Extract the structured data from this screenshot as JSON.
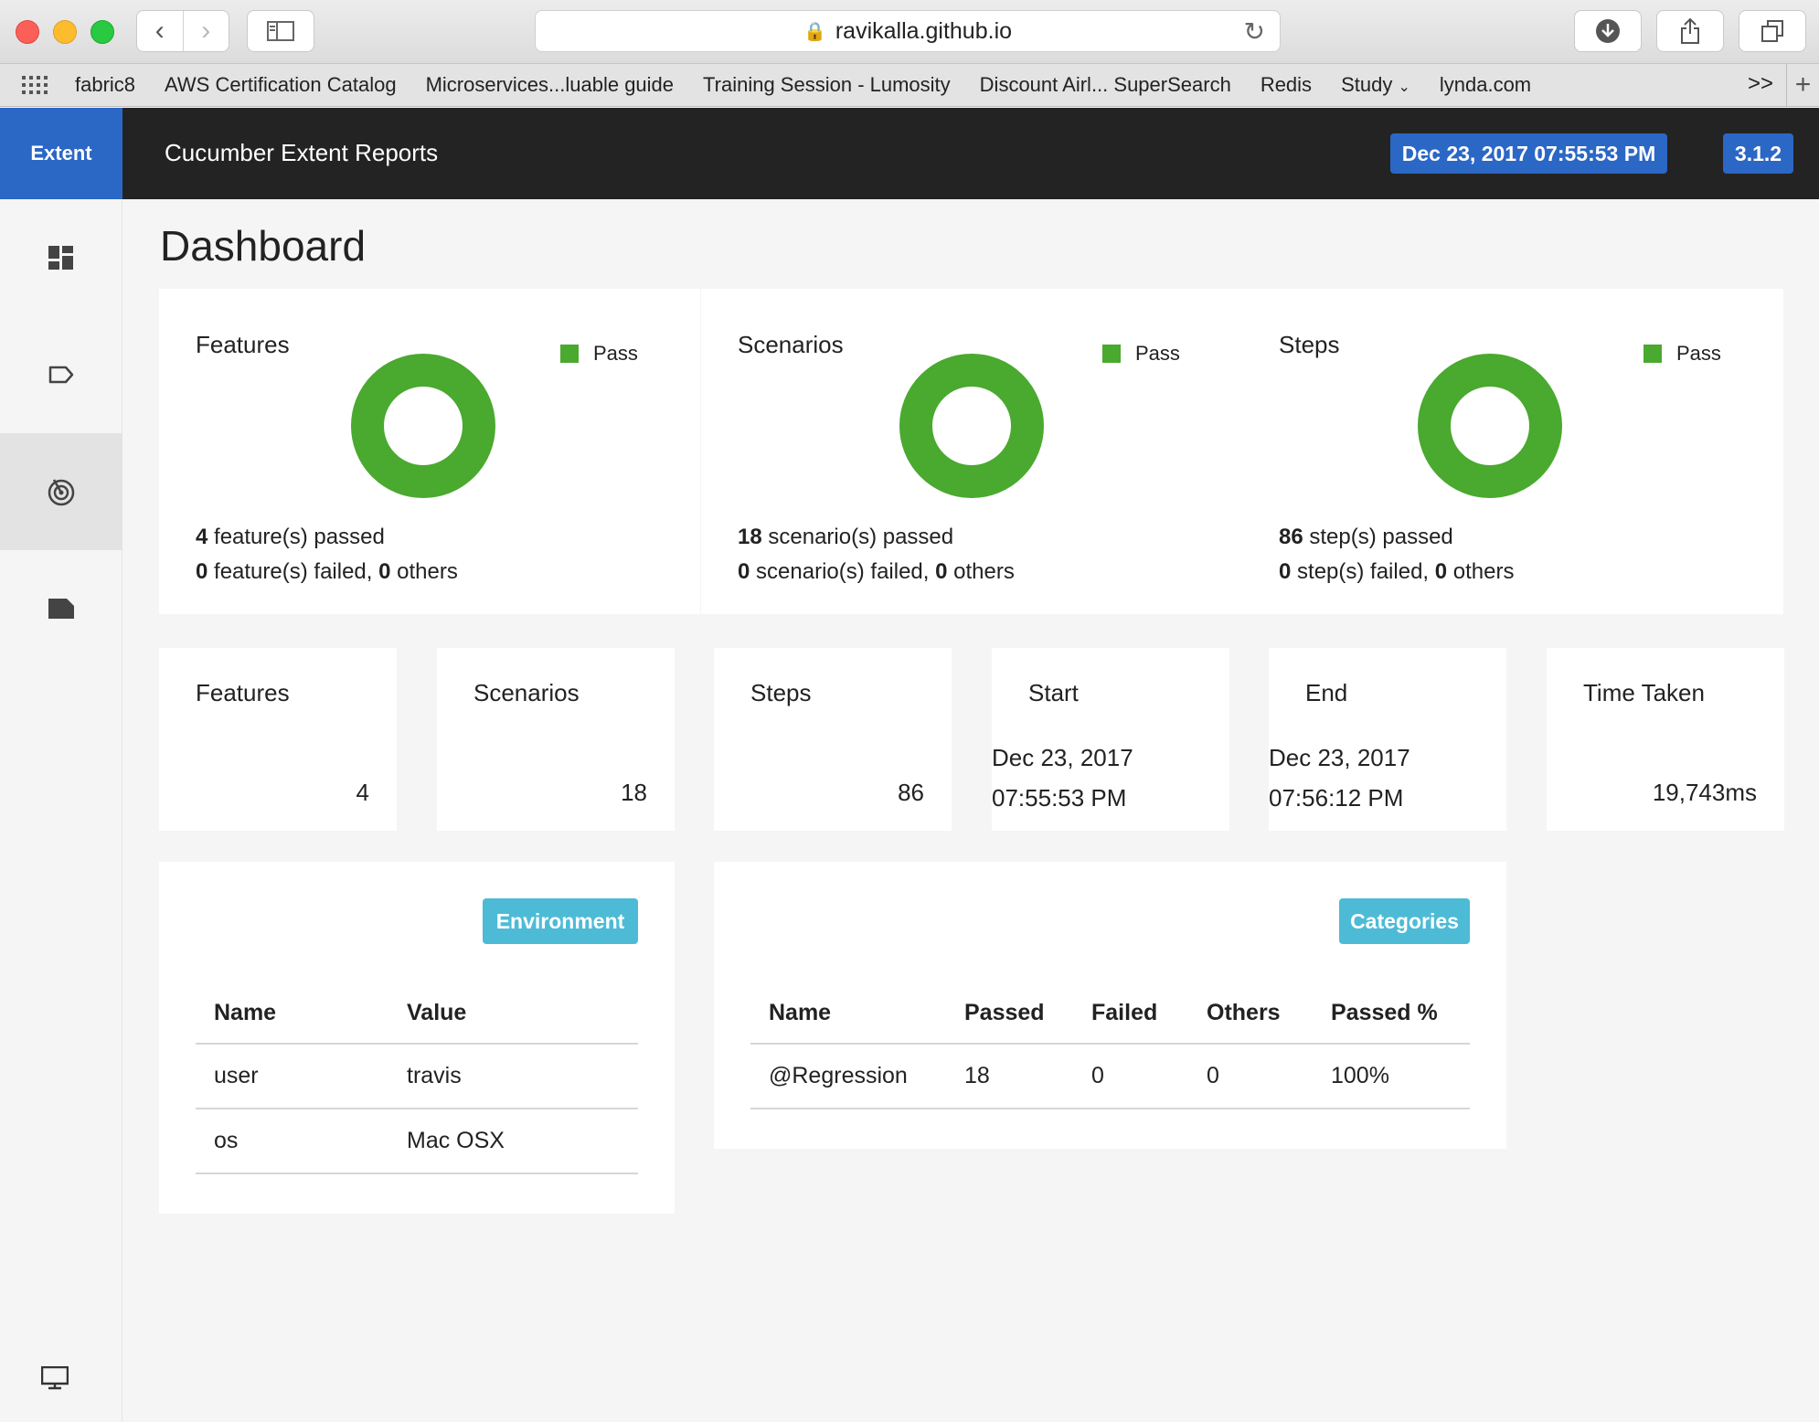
{
  "browser": {
    "url": "ravikalla.github.io",
    "bookmarks": [
      "fabric8",
      "AWS Certification Catalog",
      "Microservices...luable guide",
      "Training Session - Lumosity",
      "Discount Airl... SuperSearch",
      "Redis",
      "Study",
      "lynda.com"
    ],
    "more": ">>"
  },
  "app": {
    "brand": "Extent",
    "title": "Cucumber Extent Reports",
    "date": "Dec 23, 2017 07:55:53 PM",
    "version": "3.1.2"
  },
  "sidenav": {
    "icons": [
      "dashboard-icon",
      "tag-icon",
      "radar-icon",
      "folder-icon",
      "monitor-icon"
    ],
    "active_index": 2
  },
  "dashboard": {
    "title": "Dashboard",
    "charts": [
      {
        "title": "Features",
        "legend": "Pass",
        "passed_count": "4",
        "passed_text": " feature(s) passed",
        "failed_count": "0",
        "failed_text": " feature(s) failed, ",
        "others_count": "0",
        "others_text": " others"
      },
      {
        "title": "Scenarios",
        "legend": "Pass",
        "passed_count": "18",
        "passed_text": " scenario(s) passed",
        "failed_count": "0",
        "failed_text": " scenario(s) failed, ",
        "others_count": "0",
        "others_text": " others"
      },
      {
        "title": "Steps",
        "legend": "Pass",
        "passed_count": "86",
        "passed_text": " step(s) passed",
        "failed_count": "0",
        "failed_text": " step(s) failed, ",
        "others_count": "0",
        "others_text": " others"
      }
    ],
    "stats": [
      {
        "title": "Features",
        "value": "4"
      },
      {
        "title": "Scenarios",
        "value": "18"
      },
      {
        "title": "Steps",
        "value": "86"
      },
      {
        "title": "Start",
        "date": "Dec 23, 2017",
        "time": "07:55:53 PM"
      },
      {
        "title": "End",
        "date": "Dec 23, 2017",
        "time": "07:56:12 PM"
      },
      {
        "title": "Time Taken",
        "value": "19,743ms"
      }
    ],
    "environment": {
      "label": "Environment",
      "headers": [
        "Name",
        "Value"
      ],
      "rows": [
        [
          "user",
          "travis"
        ],
        [
          "os",
          "Mac OSX"
        ]
      ]
    },
    "categories": {
      "label": "Categories",
      "headers": [
        "Name",
        "Passed",
        "Failed",
        "Others",
        "Passed %"
      ],
      "rows": [
        [
          "@Regression",
          "18",
          "0",
          "0",
          "100%"
        ]
      ]
    }
  },
  "colors": {
    "pass": "#4aa92f",
    "brand": "#2b67c5",
    "header": "#232323",
    "badge": "#4dbbd6"
  }
}
